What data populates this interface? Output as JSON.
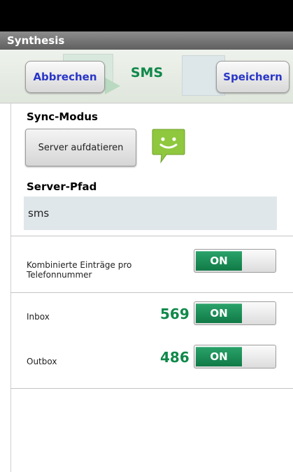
{
  "titlebar": {
    "title": "Synthesis"
  },
  "header": {
    "cancel_label": "Abbrechen",
    "title": "SMS",
    "save_label": "Speichern"
  },
  "sync": {
    "label": "Sync-Modus",
    "button_label": "Server aufdatieren",
    "icon": "sms-smiley-icon",
    "icon_color": "#8fc73e"
  },
  "server_path": {
    "label": "Server-Pfad",
    "value": "sms"
  },
  "combined": {
    "label_line1": "Kombinierte Einträge pro",
    "label_line2": "Telefonnummer",
    "toggle_label": "ON"
  },
  "inbox": {
    "label": "Inbox",
    "count": "569",
    "toggle_label": "ON"
  },
  "outbox": {
    "label": "Outbox",
    "count": "486",
    "toggle_label": "ON"
  },
  "colors": {
    "accent_green": "#10884a",
    "button_text_blue": "#2a36c8"
  }
}
